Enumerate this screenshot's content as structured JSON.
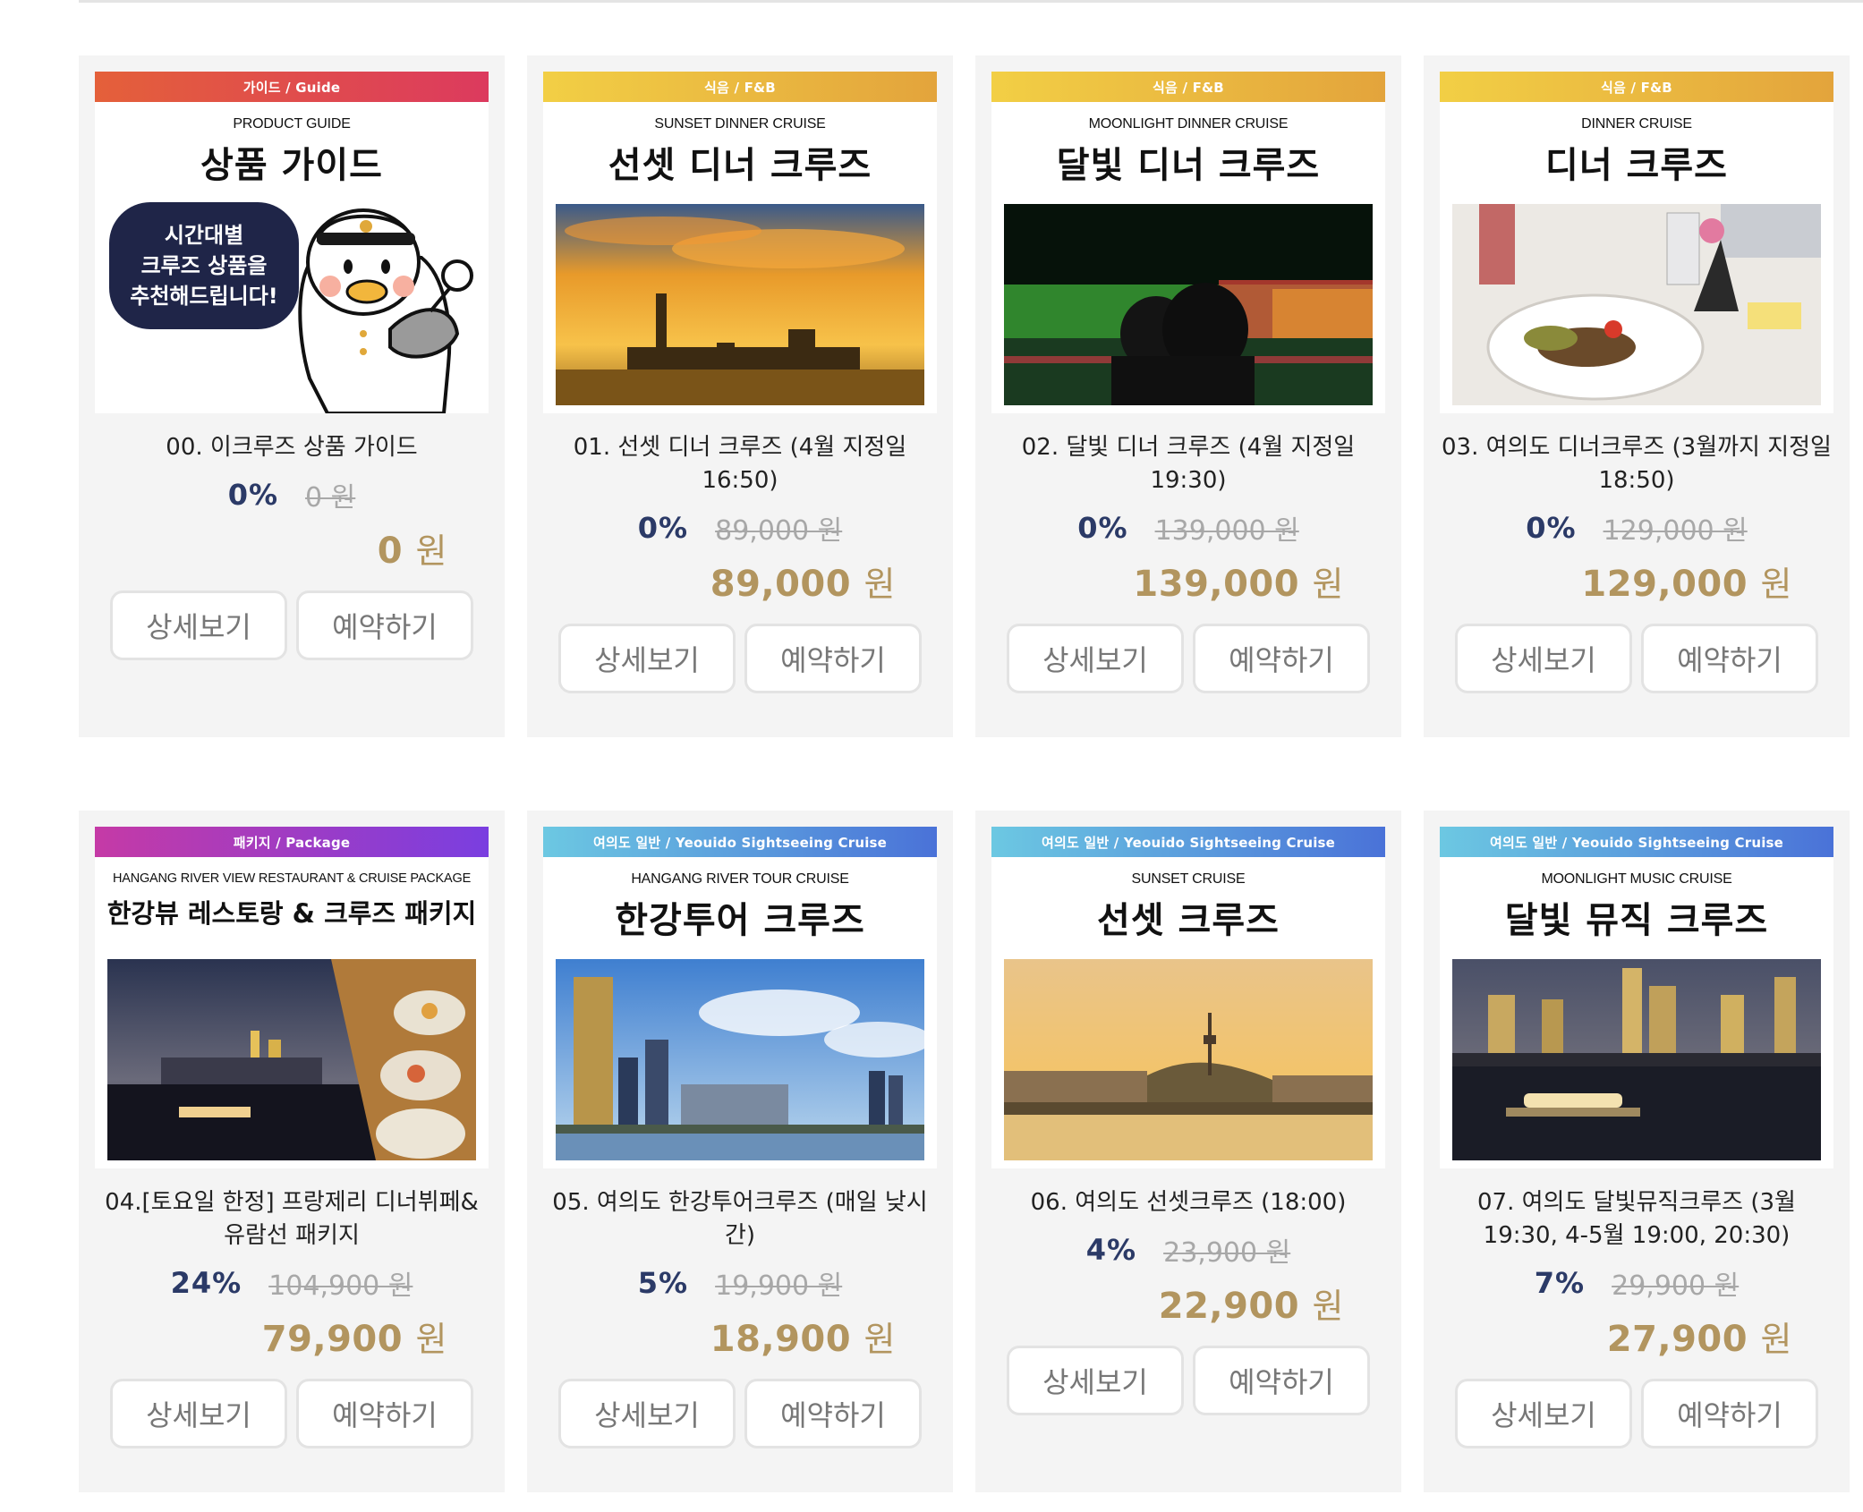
{
  "products": [
    {
      "category": "가이드 / Guide",
      "category_colors": [
        "#e4603a",
        "#dc3a5e"
      ],
      "subtitle": "PRODUCT GUIDE",
      "title": "상품 가이드",
      "bubble_text": "시간대별\n크루즈 상품을\n추천해드립니다!",
      "image": "mascot-sailor-duck",
      "name": "00. 이크루즈 상품 가이드",
      "discount": "0%",
      "original_price": "0 원",
      "sale_price": "0",
      "currency": "원",
      "detail_label": "상세보기",
      "reserve_label": "예약하기"
    },
    {
      "category": "식음 / F&B",
      "category_colors": [
        "#f2cf45",
        "#e3a43c"
      ],
      "subtitle": "SUNSET DINNER CRUISE",
      "title": "선셋 디너 크루즈",
      "image": "sunset-city-skyline-photo",
      "name": "01. 선셋 디너 크루즈 (4월 지정일 16:50)",
      "discount": "0%",
      "original_price": "89,000 원",
      "sale_price": "89,000",
      "currency": "원",
      "detail_label": "상세보기",
      "reserve_label": "예약하기"
    },
    {
      "category": "식음 / F&B",
      "category_colors": [
        "#f2cf45",
        "#e3a43c"
      ],
      "subtitle": "MOONLIGHT DINNER CRUISE",
      "title": "달빛 디너 크루즈",
      "image": "couple-rainbow-fountain-photo",
      "name": "02. 달빛 디너 크루즈 (4월 지정일 19:30)",
      "discount": "0%",
      "original_price": "139,000 원",
      "sale_price": "139,000",
      "currency": "원",
      "detail_label": "상세보기",
      "reserve_label": "예약하기"
    },
    {
      "category": "식음 / F&B",
      "category_colors": [
        "#f2cf45",
        "#e3a43c"
      ],
      "subtitle": "DINNER CRUISE",
      "title": "디너 크루즈",
      "image": "dinner-plate-photo",
      "name": "03. 여의도 디너크루즈 (3월까지 지정일 18:50)",
      "discount": "0%",
      "original_price": "129,000 원",
      "sale_price": "129,000",
      "currency": "원",
      "detail_label": "상세보기",
      "reserve_label": "예약하기"
    },
    {
      "category": "패키지 / Package",
      "category_colors": [
        "#c53aa6",
        "#7a3ee0"
      ],
      "subtitle": "HANGANG RIVER VIEW RESTAURANT & CRUISE PACKAGE",
      "title": "한강뷰 레스토랑 & 크루즈 패키지",
      "image": "night-river-buffet-photo",
      "name": "04.[토요일 한정] 프랑제리 디너뷔페& 유람선 패키지",
      "discount": "24%",
      "original_price": "104,900 원",
      "sale_price": "79,900",
      "currency": "원",
      "detail_label": "상세보기",
      "reserve_label": "예약하기"
    },
    {
      "category": "여의도 일반 / Yeouido Sightseeing Cruise",
      "category_colors": [
        "#6cc8e2",
        "#4a72d8"
      ],
      "subtitle": "HANGANG RIVER TOUR CRUISE",
      "title": "한강투어 크루즈",
      "image": "daytime-skyline-photo",
      "name": "05. 여의도 한강투어크루즈 (매일 낮시간)",
      "discount": "5%",
      "original_price": "19,900 원",
      "sale_price": "18,900",
      "currency": "원",
      "detail_label": "상세보기",
      "reserve_label": "예약하기"
    },
    {
      "category": "여의도 일반 / Yeouido Sightseeing Cruise",
      "category_colors": [
        "#6cc8e2",
        "#4a72d8"
      ],
      "subtitle": "SUNSET CRUISE",
      "title": "선셋 크루즈",
      "image": "sunset-namsan-tower-photo",
      "name": "06. 여의도 선셋크루즈 (18:00)",
      "discount": "4%",
      "original_price": "23,900 원",
      "sale_price": "22,900",
      "currency": "원",
      "detail_label": "상세보기",
      "reserve_label": "예약하기"
    },
    {
      "category": "여의도 일반 / Yeouido Sightseeing Cruise",
      "category_colors": [
        "#6cc8e2",
        "#4a72d8"
      ],
      "subtitle": "MOONLIGHT MUSIC CRUISE",
      "title": "달빛 뮤직 크루즈",
      "image": "night-skyline-cruise-photo",
      "name": "07. 여의도 달빛뮤직크루즈 (3월 19:30, 4-5월 19:00, 20:30)",
      "discount": "7%",
      "original_price": "29,900 원",
      "sale_price": "27,900",
      "currency": "원",
      "detail_label": "상세보기",
      "reserve_label": "예약하기"
    }
  ]
}
